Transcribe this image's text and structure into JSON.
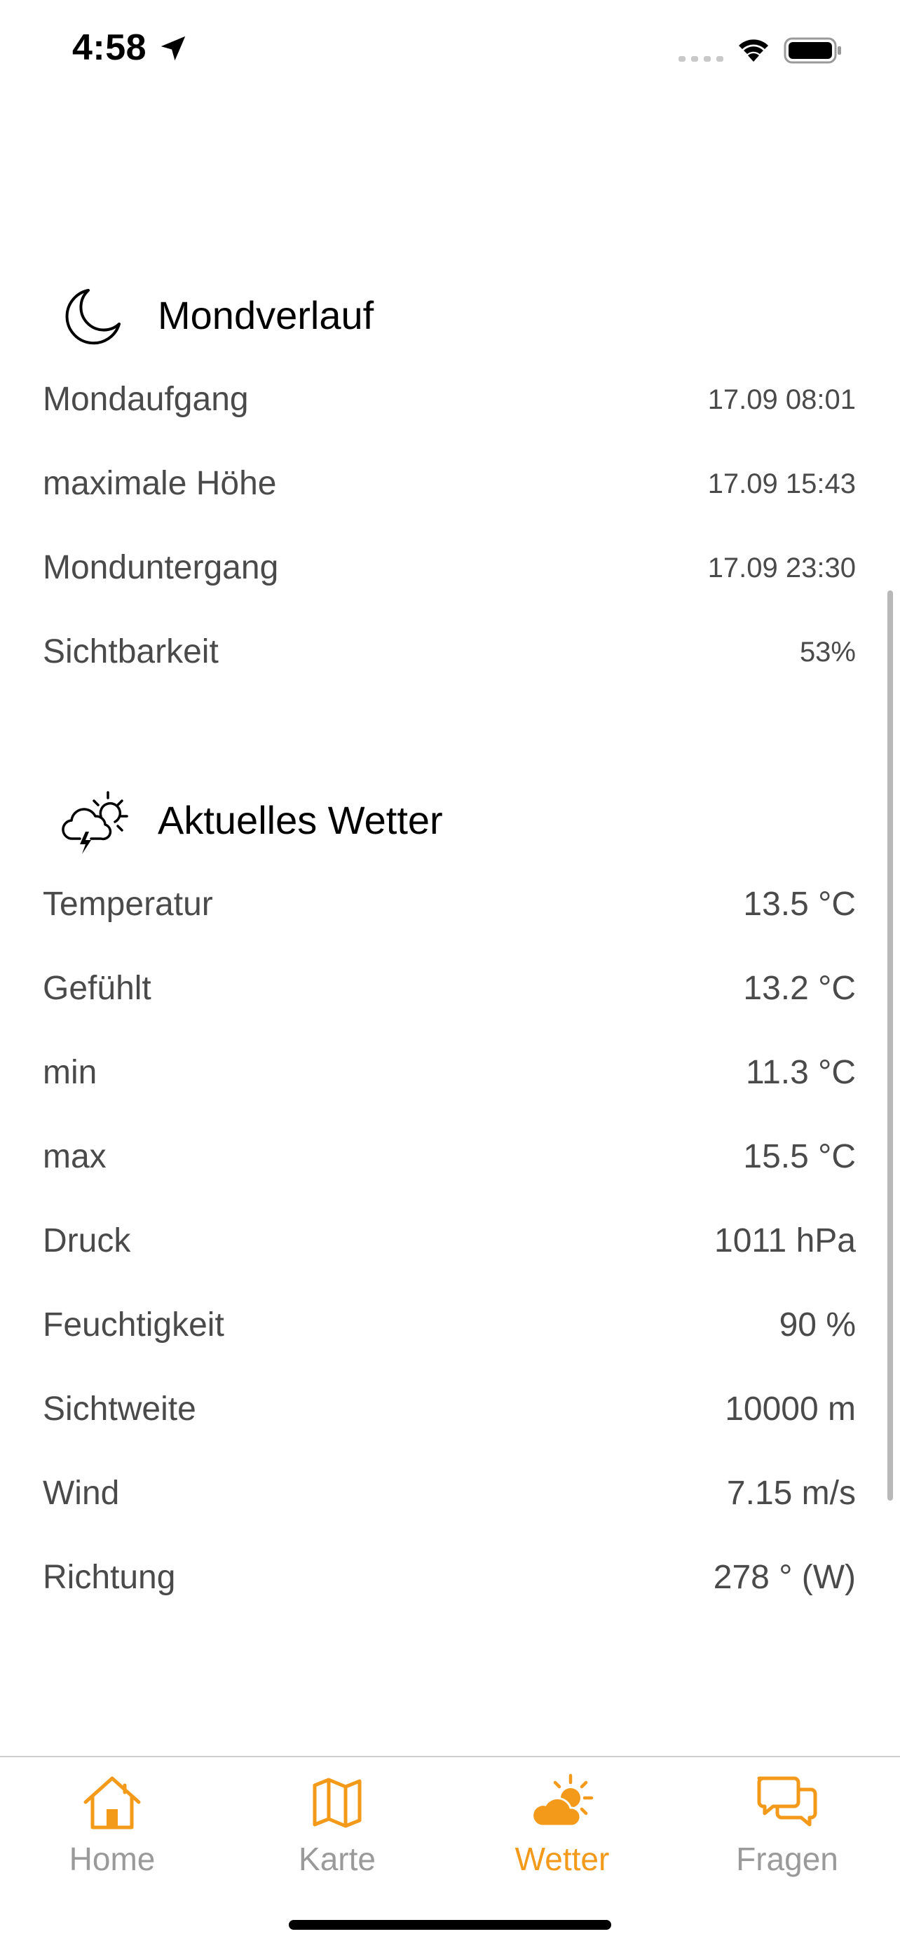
{
  "status_bar": {
    "time": "4:58"
  },
  "moon": {
    "title": "Mondverlauf",
    "rows": [
      {
        "label": "Mondaufgang",
        "value": "17.09 08:01"
      },
      {
        "label": "maximale Höhe",
        "value": "17.09 15:43"
      },
      {
        "label": "Monduntergang",
        "value": "17.09 23:30"
      },
      {
        "label": "Sichtbarkeit",
        "value": "53%"
      }
    ]
  },
  "weather": {
    "title": "Aktuelles Wetter",
    "rows": [
      {
        "label": "Temperatur",
        "value": "13.5 °C"
      },
      {
        "label": "Gefühlt",
        "value": "13.2 °C"
      },
      {
        "label": "min",
        "value": "11.3 °C"
      },
      {
        "label": "max",
        "value": "15.5 °C"
      },
      {
        "label": "Druck",
        "value": "1011 hPa"
      },
      {
        "label": "Feuchtigkeit",
        "value": "90 %"
      },
      {
        "label": "Sichtweite",
        "value": "10000 m"
      },
      {
        "label": "Wind",
        "value": "7.15 m/s"
      },
      {
        "label": "Richtung",
        "value": "278 ° (W)"
      }
    ]
  },
  "tab_bar": {
    "tabs": [
      {
        "label": "Home",
        "icon": "house-icon"
      },
      {
        "label": "Karte",
        "icon": "map-icon"
      },
      {
        "label": "Wetter",
        "icon": "cloud-sun-icon"
      },
      {
        "label": "Fragen",
        "icon": "chat-bubbles-icon"
      }
    ],
    "active": "Wetter"
  },
  "colors": {
    "accent": "#f39a1a",
    "inactive_tab": "#9a9a9a",
    "text": "#4a4a4a"
  }
}
